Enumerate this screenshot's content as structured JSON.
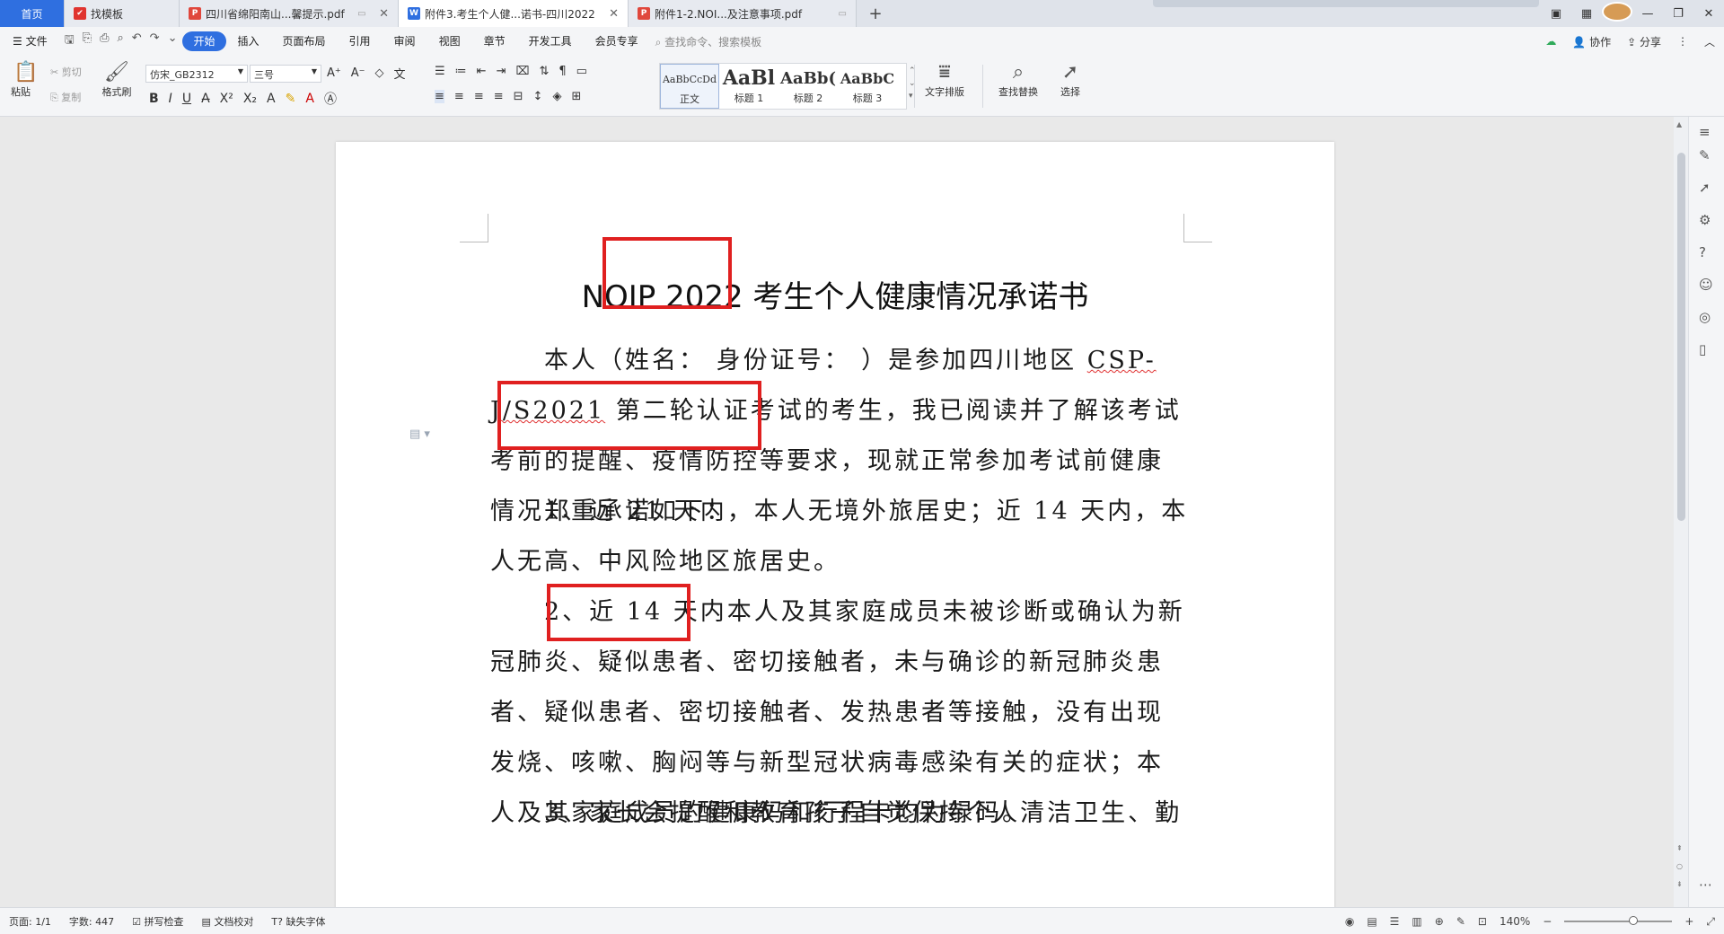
{
  "tabs": [
    {
      "label": "首页",
      "icon": "home"
    },
    {
      "label": "找模板",
      "icon": "template-icon"
    },
    {
      "label": "四川省绵阳南山...馨提示.pdf",
      "icon": "pdf-icon"
    },
    {
      "label": "附件3.考生个人健...诺书-四川2022",
      "icon": "word-icon"
    },
    {
      "label": "附件1-2.NOI...及注意事项.pdf",
      "icon": "pdf-icon"
    }
  ],
  "menu": {
    "file": "文件",
    "items": [
      "开始",
      "插入",
      "页面布局",
      "引用",
      "审阅",
      "视图",
      "章节",
      "开发工具",
      "会员专享"
    ],
    "search_placeholder": "查找命令、搜索模板",
    "collab": "协作",
    "share": "分享"
  },
  "ribbon": {
    "paste": "粘贴",
    "cut": "剪切",
    "copy": "复制",
    "format_painter": "格式刷",
    "font_name": "仿宋_GB2312",
    "font_size": "三号",
    "styles": [
      {
        "preview": "AaBbCcDd",
        "name": "正文"
      },
      {
        "preview": "AaBl",
        "name": "标题 1"
      },
      {
        "preview": "AaBb(",
        "name": "标题 2"
      },
      {
        "preview": "AaBbC",
        "name": "标题 3"
      }
    ],
    "text_layout": "文字排版",
    "find_replace": "查找替换",
    "select": "选择"
  },
  "document": {
    "title": "NOIP 2022 考生个人健康情况承诺书",
    "para1_a": "本人（姓名：      身份证号：          ）是参加四川地区 ",
    "para1_code": "CSP-J/S2021",
    "para1_b": " 第二轮认证考试的考生，我已阅读并了解该考试考前的提醒、疫情防控等要求，现就正常参加考试前健康情况郑重承诺如下：",
    "para2": "1、近 21 天内，本人无境外旅居史；近 14 天内，本人无高、中风险地区旅居史。",
    "para3": "2、近 14 天内本人及其家庭成员未被诊断或确认为新冠肺炎、疑似患者、密切接触者，未与确诊的新冠肺炎患者、疑似患者、密切接触者、发热患者等接触，没有出现发烧、咳嗽、胸闷等与新型冠状病毒感染有关的症状；本人及其家庭成员的健康码和行程卡均为绿码。",
    "para4": "3、家长会提醒和教育孩子自觉保持个人清洁卫生、勤"
  },
  "status": {
    "page": "页面: 1/1",
    "words": "字数: 447",
    "spell": "拼写检查",
    "proof": "文档校对",
    "missing_font": "缺失字体",
    "zoom": "140%"
  },
  "colors": {
    "accent": "#2f6fe0",
    "highlight_box": "#e02020"
  }
}
